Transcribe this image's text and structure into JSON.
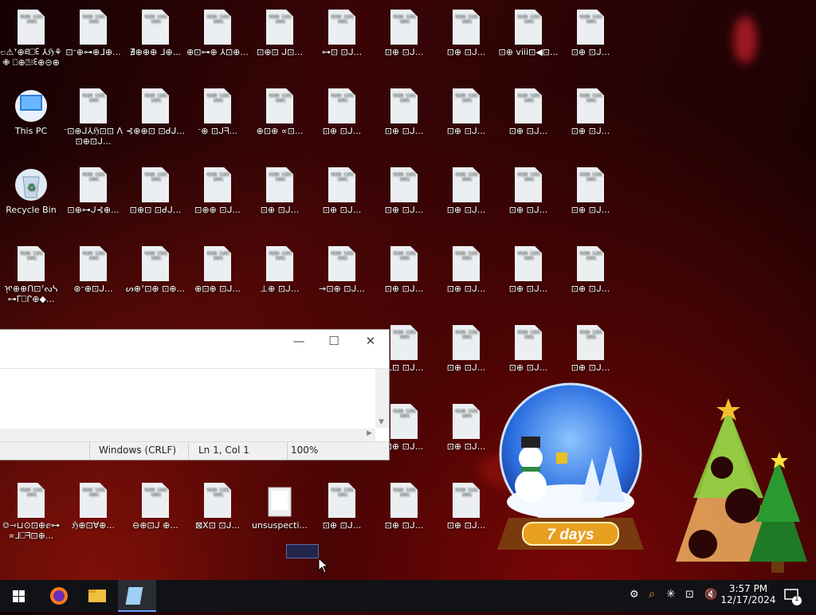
{
  "desktop": {
    "columns": [
      {
        "rows": [
          {
            "type": "doc",
            "label": "ಲ⚠ᐪ⊕ཐ⎕ᢄ ⅄ℌ⚘✙ ⎕⊕⍰⁝ᢄ⊕⊝⊕"
          },
          {
            "type": "thispc",
            "label": "This PC"
          },
          {
            "type": "bin",
            "label": "Recycle Bin"
          },
          {
            "type": "doc",
            "label": "ᢊ⊕⊕ᑎ⊡ᐪᔓᓴ ⊶ᒥ⎕ᒋ⊕◆..."
          },
          null,
          null,
          {
            "type": "doc",
            "label": "⎊⇾⊔⊙⊡⊕ⅇ⊶ ∝ᒧ⎕ᖷ⊡⊕..."
          }
        ]
      },
      {
        "rows": [
          {
            "type": "doc",
            "label": "⊡ᐨ⊕⊶⊕ᒧ⊕..."
          },
          {
            "type": "doc",
            "label": "ᐨ⊡⊕ᒍ⅄ℌ⊡⊡ ᐱ⊡⊕⊡ᒍ..."
          },
          {
            "type": "doc",
            "label": "⊡⊕⊶ᒍ⊰⊕..."
          },
          {
            "type": "doc",
            "label": "⊛ᐨ⊕⊡ᒍ..."
          },
          null,
          null,
          {
            "type": "doc",
            "label": "ℌ⊕⊡∀⊕..."
          }
        ]
      },
      {
        "rows": [
          {
            "type": "doc",
            "label": "∄⊕⊕⊕ ᒧ⊕..."
          },
          {
            "type": "doc",
            "label": "⊰⊕⊕⊡ ⊡ᑯᒍ..."
          },
          {
            "type": "doc",
            "label": "⊡⊕⊡ ⊡ᑯᒍ..."
          },
          {
            "type": "doc",
            "label": "ᔕ⊕ᐪ⊡⊕ ⊡⊕..."
          },
          null,
          null,
          {
            "type": "doc",
            "label": "⊖⊕⊡ᒍ ⊕..."
          }
        ]
      },
      {
        "rows": [
          {
            "type": "doc",
            "label": "⊕⊡⊶⊕ ⅄⊡⊕..."
          },
          {
            "type": "doc",
            "label": "ᐨ⊕ ⊡ᒍᖷ..."
          },
          {
            "type": "doc",
            "label": "⊡⊕⊕ ⊡ᒍ..."
          },
          {
            "type": "doc",
            "label": "⊕⊡⊕ ⊡ᒍ..."
          },
          null,
          null,
          {
            "type": "doc",
            "label": "⊠X⊡ ⊡ᒍ..."
          }
        ]
      },
      {
        "rows": [
          {
            "type": "doc",
            "label": "⊡⊕⊡ ᒍ⊡..."
          },
          {
            "type": "doc",
            "label": "⊕⊡⊕ ∝⊡..."
          },
          {
            "type": "doc",
            "label": "⊡⊕ ⊡ᒍ..."
          },
          {
            "type": "doc",
            "label": "⊥⊕ ⊡ᒍ..."
          },
          null,
          null,
          {
            "type": "folder",
            "label": "unsuspecti..."
          }
        ]
      },
      {
        "rows": [
          {
            "type": "doc",
            "label": "⊶⊡ ⊡ᒍ..."
          },
          {
            "type": "doc",
            "label": "⊡⊕ ⊡ᒍ..."
          },
          {
            "type": "doc",
            "label": "⊡⊕ ⊡ᒍ..."
          },
          {
            "type": "doc",
            "label": "→⊡⊕ ⊡ᒍ..."
          },
          null,
          null,
          {
            "type": "doc",
            "label": "⊡⊕ ⊡ᒍ..."
          }
        ]
      },
      {
        "rows": [
          {
            "type": "doc",
            "label": "⊡⊕ ⊡ᒍ..."
          },
          {
            "type": "doc",
            "label": "⊡⊕ ⊡ᒍ..."
          },
          {
            "type": "doc",
            "label": "⊡⊕ ⊡ᒍ..."
          },
          {
            "type": "doc",
            "label": "⊡⊕ ⊡ᒍ..."
          },
          {
            "type": "doc",
            "label": "ᓚ⊡ ⊡ᒍ..."
          },
          {
            "type": "doc",
            "label": "⊡⊕ ⊡ᒍ..."
          },
          {
            "type": "doc",
            "label": "⊡⊕ ⊡ᒍ..."
          }
        ]
      },
      {
        "rows": [
          {
            "type": "doc",
            "label": "⊡⊕ ⊡ᒍ..."
          },
          {
            "type": "doc",
            "label": "⊡⊕ ⊡ᒍ..."
          },
          {
            "type": "doc",
            "label": "⊡⊕ ⊡ᒍ..."
          },
          {
            "type": "doc",
            "label": "⊡⊕ ⊡ᒍ..."
          },
          {
            "type": "doc",
            "label": "⊡⊕ ⊡ᒍ..."
          },
          {
            "type": "doc",
            "label": "⊡⊕ ⊡ᒍ..."
          },
          {
            "type": "doc",
            "label": "⊡⊕ ⊡ᒍ..."
          }
        ]
      },
      {
        "rows": [
          {
            "type": "doc",
            "label": "⊡⊕ viii⊡◀⊡..."
          },
          {
            "type": "doc",
            "label": "⊡⊕ ⊡ᒍ..."
          },
          {
            "type": "doc",
            "label": "⊡⊕ ⊡ᒍ..."
          },
          {
            "type": "doc",
            "label": "⊡⊕ ⊡ᒍ..."
          },
          {
            "type": "doc",
            "label": "⊡⊕ ⊡ᒍ..."
          },
          null,
          null
        ]
      },
      {
        "rows": [
          {
            "type": "doc",
            "label": "⊡⊕ ⊡ᒍ..."
          },
          {
            "type": "doc",
            "label": "⊡⊕ ⊡ᒍ..."
          },
          {
            "type": "doc",
            "label": "⊡⊕ ⊡ᒍ..."
          },
          {
            "type": "doc",
            "label": "⊡⊕ ⊡ᒍ..."
          },
          {
            "type": "doc",
            "label": "⊡⊕ ⊡ᒍ..."
          },
          null,
          null
        ]
      }
    ],
    "doc_glyph": "0100 1101 1001"
  },
  "notepad": {
    "min": "—",
    "max": "☐",
    "close": "✕",
    "status_eol": "Windows (CRLF)",
    "status_pos": "Ln 1, Col 1",
    "status_zoom": "100%"
  },
  "globe_widget": {
    "days_text": "7 days"
  },
  "taskbar": {
    "clock_time": "3:57 PM",
    "clock_date": "12/17/2024",
    "notif_count": "1"
  },
  "colors": {
    "taskbar": "#111216",
    "accent": "#1e73be"
  }
}
